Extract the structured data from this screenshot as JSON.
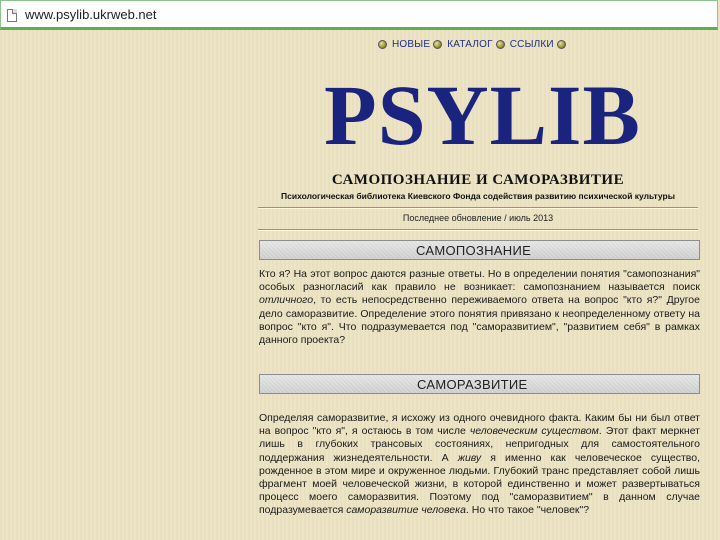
{
  "browser": {
    "url": "www.psylib.ukrweb.net"
  },
  "nav": {
    "items": [
      "НОВЫЕ",
      "КАТАЛОГ",
      "ССЫЛКИ"
    ]
  },
  "header": {
    "logo": "PSYLIB",
    "subtitle": "САМОПОЗНАНИЕ И САМОРАЗВИТИЕ",
    "tagline": "Психологическая библиотека Киевского Фонда содействия развитию психической культуры",
    "updated": "Последнее обновление / июль 2013"
  },
  "sections": [
    {
      "title": "САМОПОЗНАНИЕ",
      "paragraph": {
        "p1": "Кто я? На этот вопрос даются разные ответы. Но в определении понятия \"самопознания\" особых разногласий как правило не возникает: самопознанием называется поиск ",
        "em1": "отличного",
        "p2": ", то есть непосредственно переживаемого ответа на вопрос \"кто я?\" Другое дело саморазвитие. Определение этого понятия привязано к неопределенному ответу на вопрос \"кто я\". Что подразумевается под \"саморазвитием\", \"развитием себя\" в рамках данного проекта?"
      }
    },
    {
      "title": "САМОРАЗВИТИЕ",
      "paragraph": {
        "p1": "Определяя саморазвитие, я исхожу из одного очевидного факта. Каким бы ни был ответ на вопрос \"кто я\", я остаюсь в том числе ",
        "em1": "человеческим существом",
        "p2": ". Этот факт меркнет лишь в глубоких трансовых состояниях, непригодных для самостоятельного поддержания жизнедеятельности. А ",
        "em2": "живу",
        "p3": " я именно как человеческое существо, рожденное в этом мире и окруженное людьми. Глубокий транс представляет собой лишь фрагмент моей человеческой жизни, в которой единственно и может развертываться процесс моего саморазвития. Поэтому под \"саморазвитием\" в данном случае подразумевается ",
        "em3": "саморазвитие человека",
        "p4": ". Но что такое \"человек\"?"
      }
    }
  ]
}
